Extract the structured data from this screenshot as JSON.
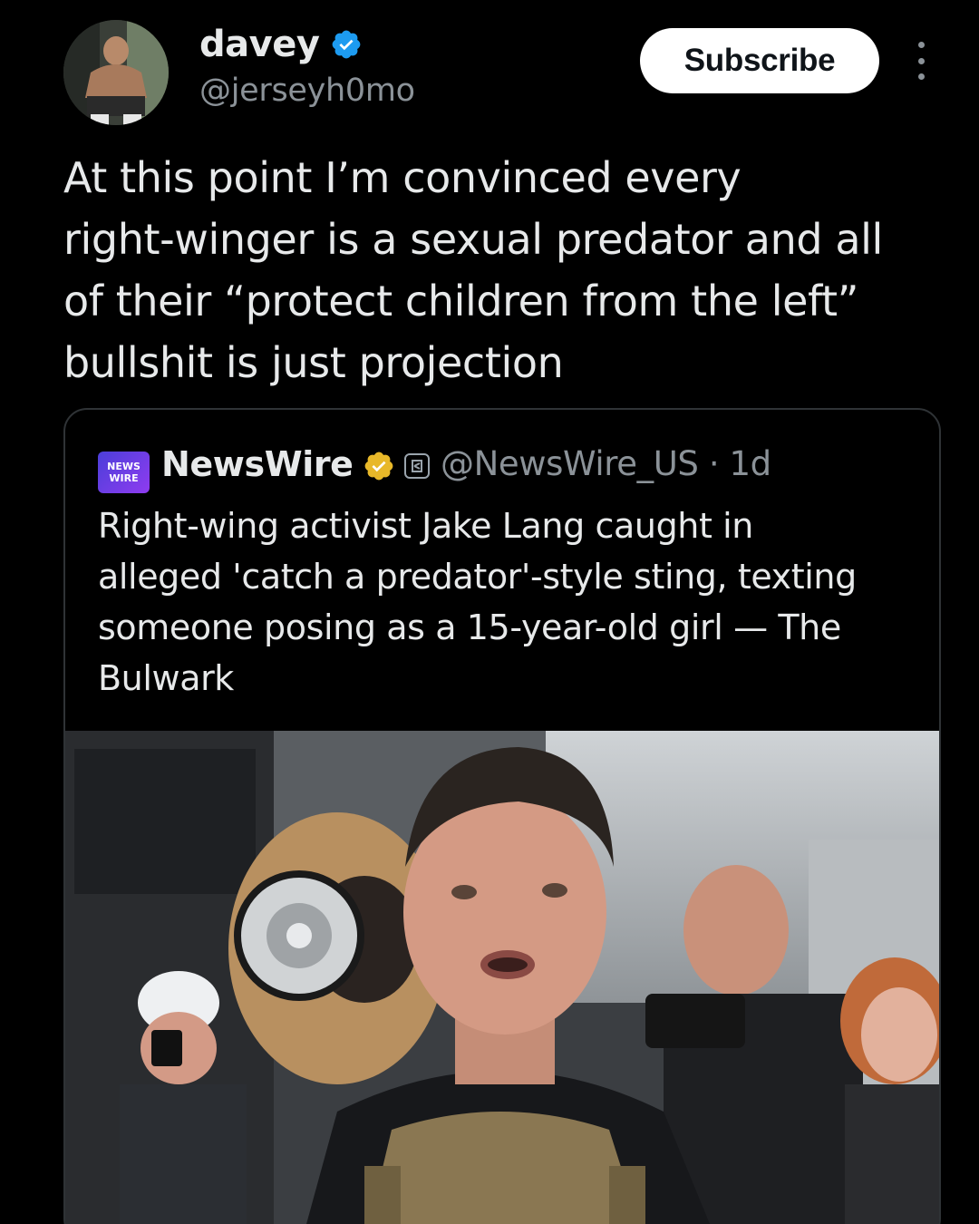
{
  "author": {
    "display_name": "davey",
    "handle": "@jerseyh0mo",
    "avatar_icon": "avatar-photo"
  },
  "header": {
    "subscribe_label": "Subscribe",
    "more_icon": "more-vertical-icon"
  },
  "tweet": {
    "lines": [
      "At this point I’m convinced every",
      "right-winger is a sexual predator and all",
      "of their “protect children from the left”",
      "bullshit is just projection"
    ]
  },
  "quote": {
    "logo_text": [
      "NEWS",
      "WIRE"
    ],
    "display_name": "NewsWire",
    "handle_time": "@NewsWire_US · 1d",
    "lines": [
      "Right-wing activist Jake Lang caught in",
      "alleged 'catch a predator'-style sting, texting",
      "someone posing as a 15-year-old girl — The",
      "Bulwark"
    ]
  },
  "colors": {
    "background": "#000000",
    "text": "#e7e9ea",
    "secondary_text": "#8b9298",
    "verified_blue": "#1d9bf0",
    "verified_gold": "#e8b829",
    "border": "#2f3336"
  }
}
